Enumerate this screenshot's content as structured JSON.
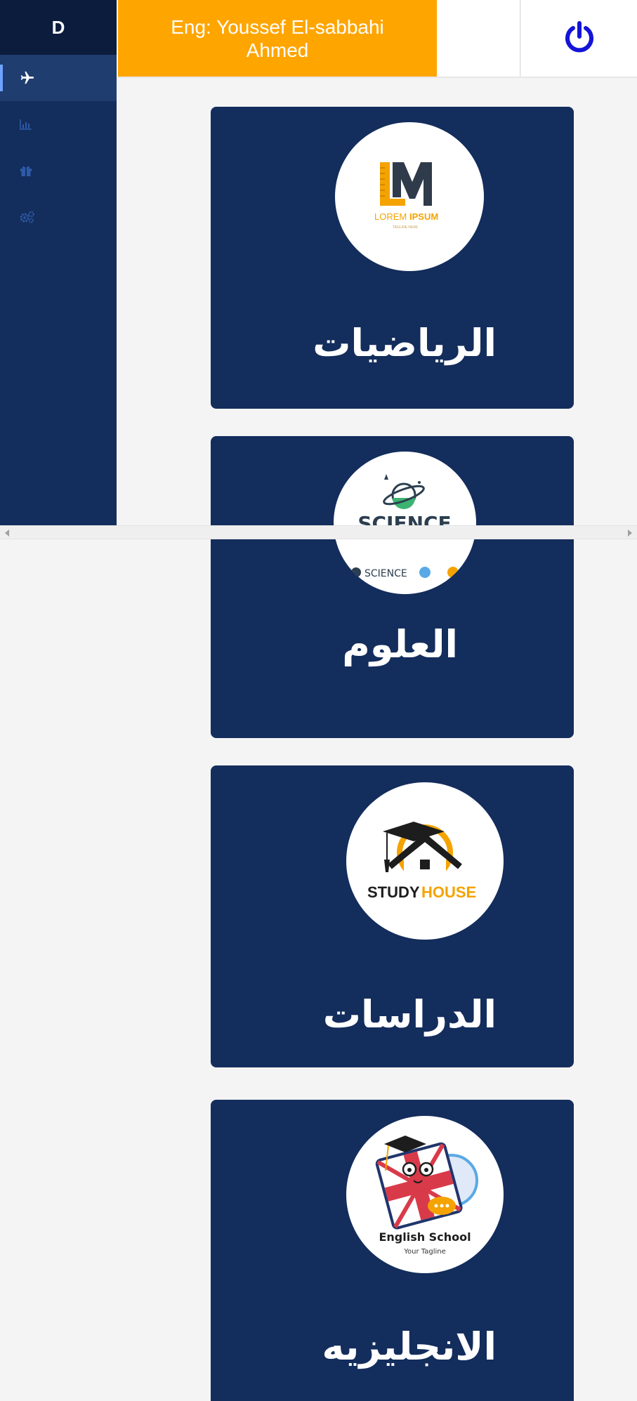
{
  "sidebar": {
    "brand": "D",
    "items": [
      {
        "icon": "plane-icon",
        "active": true
      },
      {
        "icon": "chart-icon",
        "active": false
      },
      {
        "icon": "gift-icon",
        "active": false
      },
      {
        "icon": "cogs-icon",
        "active": false
      }
    ]
  },
  "header": {
    "user_name": "Eng: Youssef El-sabbahi Ahmed",
    "power_icon": "power-icon"
  },
  "colors": {
    "sidebar_bg": "#132d5c",
    "brand_bg": "#0b1c3d",
    "header_accent": "#ffa500",
    "card_bg": "#132d5c",
    "power_icon": "#1414d8"
  },
  "cards": [
    {
      "title": "الرياضيات",
      "logo": {
        "type": "lm-logo",
        "text_left": "LOREM",
        "text_right": "IPSUM",
        "tagline": "TAGLINE HERE"
      }
    },
    {
      "title": "العلوم",
      "logo": {
        "type": "science-logo",
        "text": "SCIENCE",
        "sub_text": "SCIENCE"
      }
    },
    {
      "title": "الدراسات",
      "logo": {
        "type": "studyhouse-logo",
        "text_left": "STUDY",
        "text_right": "HOUSE"
      }
    },
    {
      "title": "الانجليزيه",
      "logo": {
        "type": "english-school-logo",
        "text": "English School",
        "tagline": "Your Tagline"
      }
    }
  ]
}
